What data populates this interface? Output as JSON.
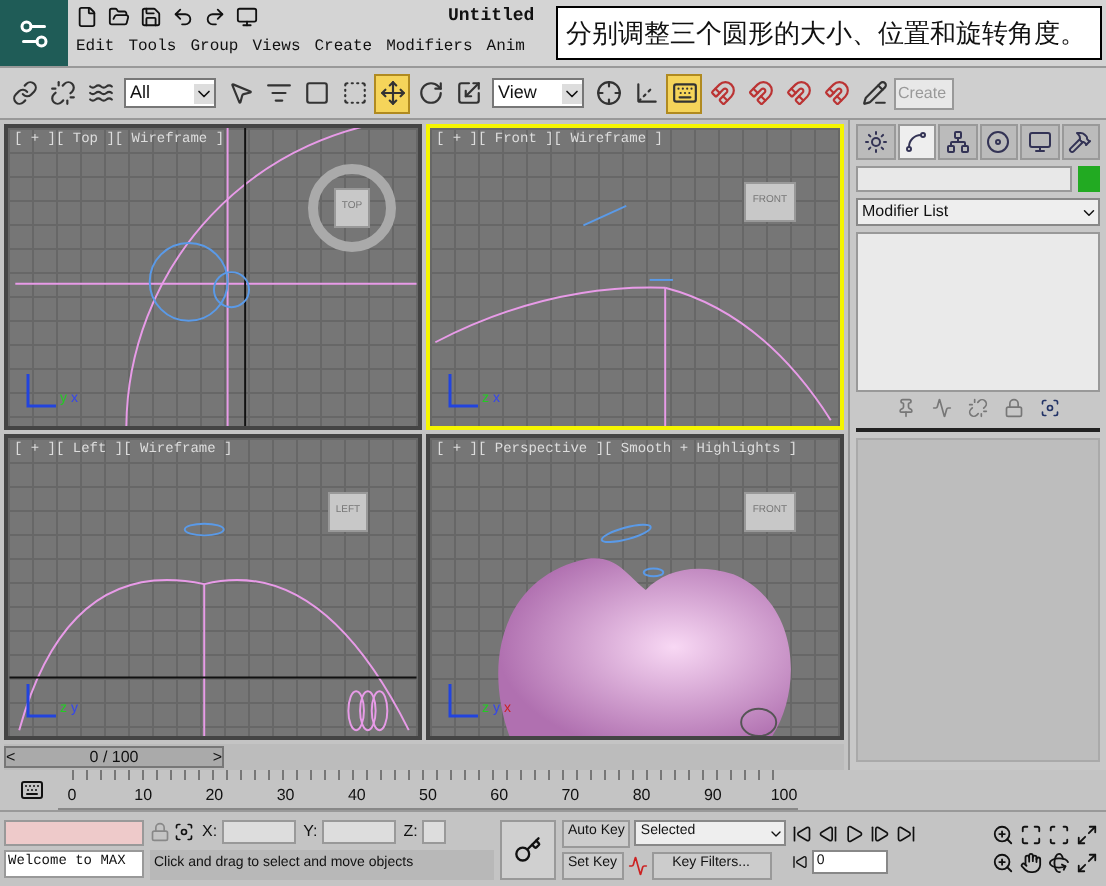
{
  "title_bar": {
    "title": "Untitled",
    "menus": [
      "Edit",
      "Tools",
      "Group",
      "Views",
      "Create",
      "Modifiers",
      "Anim"
    ]
  },
  "callout": "分别调整三个圆形的大小、位置和旋转角度。",
  "main_toolbar": [
    {
      "kind": "link",
      "selected": false
    },
    {
      "kind": "unlink",
      "selected": false
    },
    {
      "kind": "bind",
      "selected": false
    },
    {
      "kind": "dropdown",
      "value": "All"
    },
    {
      "kind": "select",
      "selected": false
    },
    {
      "kind": "select-by-name",
      "selected": false
    },
    {
      "kind": "region",
      "selected": false
    },
    {
      "kind": "window",
      "selected": false
    },
    {
      "kind": "move",
      "selected": true
    },
    {
      "kind": "rotate",
      "selected": false
    },
    {
      "kind": "scale",
      "selected": false
    },
    {
      "kind": "dropdown",
      "value": "View"
    },
    {
      "kind": "pivot",
      "selected": false
    },
    {
      "kind": "manipulate",
      "selected": false
    },
    {
      "kind": "keyboard",
      "selected": true
    },
    {
      "kind": "snap",
      "selected": false
    },
    {
      "kind": "angle-snap",
      "selected": false
    },
    {
      "kind": "percent-snap",
      "selected": false
    },
    {
      "kind": "spinner-snap",
      "selected": false
    },
    {
      "kind": "edit-named",
      "selected": false
    },
    {
      "kind": "field",
      "placeholder": "Create"
    }
  ],
  "viewports": [
    {
      "label": "[ + ][ Top ][ Wireframe ]",
      "kind": "top",
      "active": false,
      "viewcube": "TOP",
      "axes": [
        "y",
        "x"
      ]
    },
    {
      "label": "[ + ][ Front ][ Wireframe ]",
      "kind": "front",
      "active": true,
      "viewcube": "FRONT",
      "axes": [
        "z",
        "x"
      ]
    },
    {
      "label": "[ + ][ Left ][ Wireframe ]",
      "kind": "left",
      "active": false,
      "viewcube": "LEFT",
      "axes": [
        "z",
        "y"
      ]
    },
    {
      "label": "[ + ][ Perspective ][ Smooth + Highlights ]",
      "kind": "perspective",
      "active": false,
      "viewcube": "FRONT",
      "axes": [
        "z",
        "y",
        "x"
      ]
    }
  ],
  "command_panel": {
    "tabs": [
      {
        "kind": "create",
        "selected": false
      },
      {
        "kind": "modify",
        "selected": true
      },
      {
        "kind": "hierarchy",
        "selected": false
      },
      {
        "kind": "motion",
        "selected": false
      },
      {
        "kind": "display",
        "selected": false
      },
      {
        "kind": "utilities",
        "selected": false
      }
    ],
    "modifier_list": "Modifier List"
  },
  "timeline": {
    "frame_slider": "0 / 100",
    "level": 0,
    "prev": "<",
    "next": ">",
    "ruler_labels": [
      "0",
      "10",
      "20",
      "30",
      "40",
      "50",
      "60",
      "70",
      "80",
      "90",
      "100"
    ]
  },
  "status": {
    "welcome": "Welcome to MAX",
    "coords": [
      "X:",
      "Y:",
      "Z:"
    ],
    "prompt": "Click and drag to select and move objects",
    "auto_key": "Auto Key",
    "set_key": "Set Key",
    "key_mode": "Selected",
    "key_filters": "Key Filters...",
    "current_frame": "0"
  }
}
